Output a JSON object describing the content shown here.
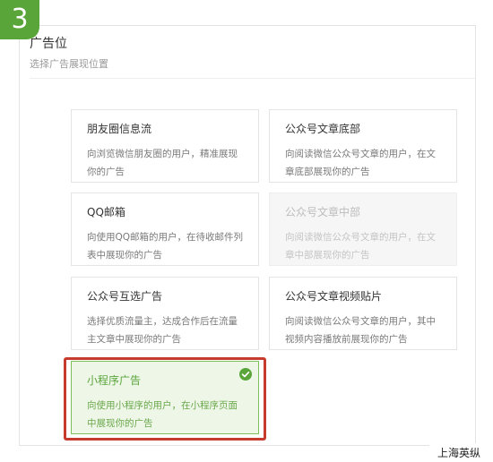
{
  "step": {
    "number": "3"
  },
  "section": {
    "title": "广告位",
    "subtitle": "选择广告展现位置"
  },
  "placements": [
    {
      "title": "朋友圈信息流",
      "description": "向浏览微信朋友圈的用户，精准展现你的广告",
      "state": "default"
    },
    {
      "title": "公众号文章底部",
      "description": "向阅读微信公众号文章的用户，在文章底部展现你的广告",
      "state": "default"
    },
    {
      "title": "QQ邮箱",
      "description": "向使用QQ邮箱的用户，在待收邮件列表中展现你的广告",
      "state": "default"
    },
    {
      "title": "公众号文章中部",
      "description": "向阅读微信公众号文章的用户，在文章中部展现你的广告",
      "state": "disabled"
    },
    {
      "title": "公众号互选广告",
      "description": "选择优质流量主，达成合作后在流量主文章中展现你的广告",
      "state": "default"
    },
    {
      "title": "公众号文章视频贴片",
      "description": "向阅读微信公众号文章的用户，其中视频内容播放前展现你的广告",
      "state": "default"
    },
    {
      "title": "小程序广告",
      "description": "向使用小程序的用户，在小程序页面中展现你的广告",
      "state": "selected",
      "icon": "check-circle-icon"
    }
  ],
  "watermark": {
    "text": "上海英纵"
  },
  "colors": {
    "accent_green": "#5aa53a",
    "selected_background": "#eef6e8",
    "highlight_red": "#c73a2e",
    "disabled_background": "#f6f6f6"
  }
}
